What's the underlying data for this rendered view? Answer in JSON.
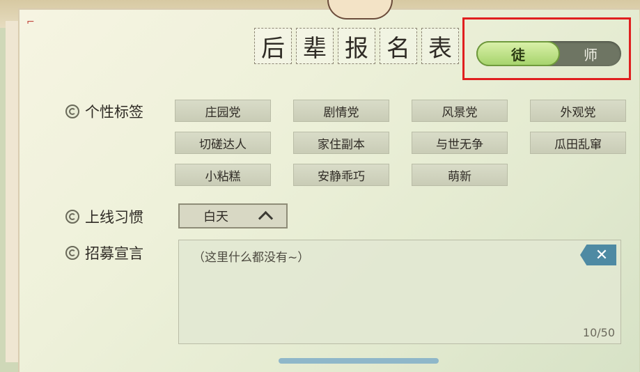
{
  "header": {
    "title_chars": [
      "后",
      "辈",
      "报",
      "名",
      "表"
    ]
  },
  "role_toggle": {
    "active_label": "徒",
    "inactive_label": "师"
  },
  "sections": {
    "tags_label": "个性标签",
    "habit_label": "上线习惯",
    "declaration_label": "招募宣言"
  },
  "tags": [
    "庄园党",
    "剧情党",
    "风景党",
    "外观党",
    "切磋达人",
    "家住副本",
    "与世无争",
    "瓜田乱窜",
    "小粘糕",
    "安静乖巧",
    "萌新"
  ],
  "habit": {
    "selected": "白天"
  },
  "declaration": {
    "placeholder": "（这里什么都没有~）",
    "counter": "10/50",
    "clear_symbol": "✕"
  },
  "colors": {
    "accent_green": "#a7d46d",
    "highlight_red": "#e01f1f",
    "clear_blue": "#4e8aa3"
  }
}
